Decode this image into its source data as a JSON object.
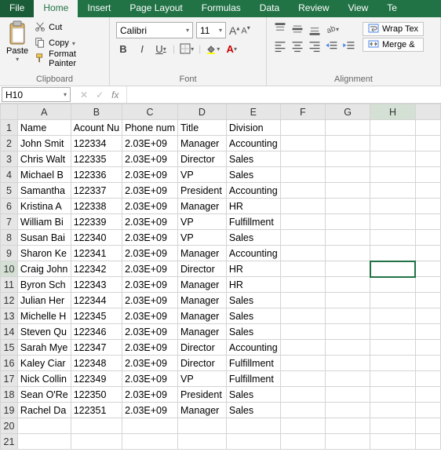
{
  "tabs": [
    "File",
    "Home",
    "Insert",
    "Page Layout",
    "Formulas",
    "Data",
    "Review",
    "View",
    "Te"
  ],
  "active_tab_index": 1,
  "clipboard": {
    "paste": "Paste",
    "cut": "Cut",
    "copy": "Copy",
    "format_painter": "Format Painter",
    "group_label": "Clipboard"
  },
  "font": {
    "name": "Calibri",
    "size": "11",
    "grow_label": "A",
    "shrink_label": "A",
    "bold": "B",
    "italic": "I",
    "underline": "U",
    "group_label": "Font"
  },
  "alignment": {
    "wrap": "Wrap Tex",
    "merge": "Merge &",
    "group_label": "Alignment"
  },
  "namebox": "H10",
  "fx_symbol": "fx",
  "columns": [
    "A",
    "B",
    "C",
    "D",
    "E",
    "F",
    "G",
    "H",
    ""
  ],
  "selected_cell": {
    "row": 10,
    "col": "H"
  },
  "headers": [
    "Name",
    "Acount Nu",
    "Phone num",
    "Title",
    "Division"
  ],
  "rows": [
    {
      "n": 1,
      "name": "Name",
      "acct": "Acount Nu",
      "phone": "Phone num",
      "title": "Title",
      "division": "Division",
      "is_header": true
    },
    {
      "n": 2,
      "name": "John Smit",
      "acct": "122334",
      "phone": "2.03E+09",
      "title": "Manager",
      "division": "Accounting"
    },
    {
      "n": 3,
      "name": "Chris Walt",
      "acct": "122335",
      "phone": "2.03E+09",
      "title": "Director",
      "division": "Sales"
    },
    {
      "n": 4,
      "name": "Michael B",
      "acct": "122336",
      "phone": "2.03E+09",
      "title": "VP",
      "division": "Sales"
    },
    {
      "n": 5,
      "name": "Samantha",
      "acct": "122337",
      "phone": "2.03E+09",
      "title": "President",
      "division": "Accounting"
    },
    {
      "n": 6,
      "name": "Kristina A",
      "acct": "122338",
      "phone": "2.03E+09",
      "title": "Manager",
      "division": "HR"
    },
    {
      "n": 7,
      "name": "William Bi",
      "acct": "122339",
      "phone": "2.03E+09",
      "title": "VP",
      "division": "Fulfillment"
    },
    {
      "n": 8,
      "name": "Susan Bai",
      "acct": "122340",
      "phone": "2.03E+09",
      "title": "VP",
      "division": "Sales"
    },
    {
      "n": 9,
      "name": "Sharon Ke",
      "acct": "122341",
      "phone": "2.03E+09",
      "title": "Manager",
      "division": "Accounting"
    },
    {
      "n": 10,
      "name": "Craig John",
      "acct": "122342",
      "phone": "2.03E+09",
      "title": "Director",
      "division": "HR"
    },
    {
      "n": 11,
      "name": "Byron Sch",
      "acct": "122343",
      "phone": "2.03E+09",
      "title": "Manager",
      "division": "HR"
    },
    {
      "n": 12,
      "name": "Julian Her",
      "acct": "122344",
      "phone": "2.03E+09",
      "title": "Manager",
      "division": "Sales"
    },
    {
      "n": 13,
      "name": "Michelle H",
      "acct": "122345",
      "phone": "2.03E+09",
      "title": "Manager",
      "division": "Sales"
    },
    {
      "n": 14,
      "name": "Steven Qu",
      "acct": "122346",
      "phone": "2.03E+09",
      "title": "Manager",
      "division": "Sales"
    },
    {
      "n": 15,
      "name": "Sarah Mye",
      "acct": "122347",
      "phone": "2.03E+09",
      "title": "Director",
      "division": "Accounting"
    },
    {
      "n": 16,
      "name": "Kaley Ciar",
      "acct": "122348",
      "phone": "2.03E+09",
      "title": "Director",
      "division": "Fulfillment"
    },
    {
      "n": 17,
      "name": "Nick Collin",
      "acct": "122349",
      "phone": "2.03E+09",
      "title": "VP",
      "division": "Fulfillment"
    },
    {
      "n": 18,
      "name": "Sean O'Re",
      "acct": "122350",
      "phone": "2.03E+09",
      "title": "President",
      "division": "Sales"
    },
    {
      "n": 19,
      "name": "Rachel Da",
      "acct": "122351",
      "phone": "2.03E+09",
      "title": "Manager",
      "division": "Sales"
    },
    {
      "n": 20,
      "name": "",
      "acct": "",
      "phone": "",
      "title": "",
      "division": ""
    },
    {
      "n": 21,
      "name": "",
      "acct": "",
      "phone": "",
      "title": "",
      "division": ""
    }
  ]
}
